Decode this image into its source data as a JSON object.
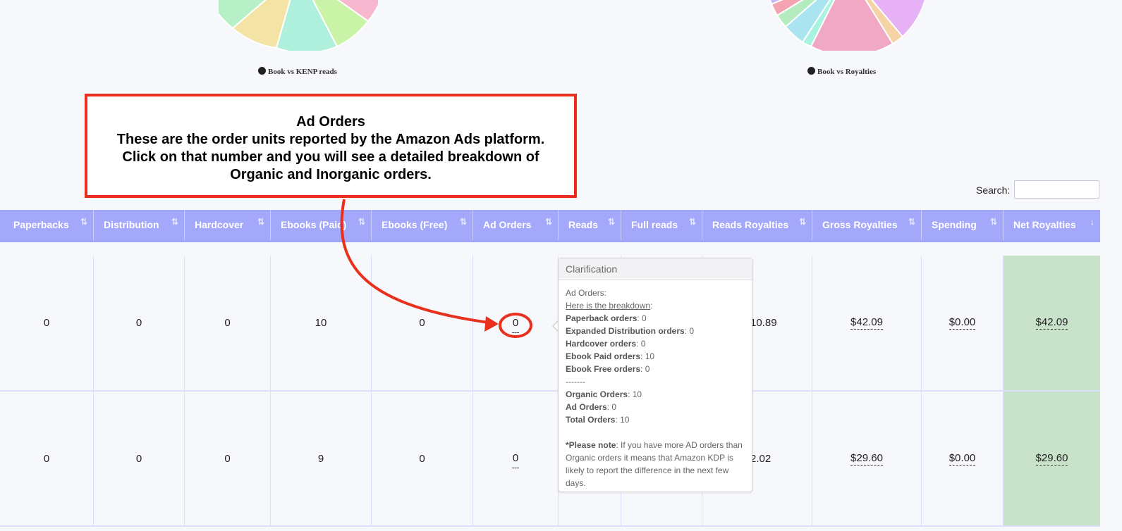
{
  "pies": [
    {
      "legend": "Book vs KENP reads",
      "slices": [
        {
          "color": "#b7f0c6"
        },
        {
          "color": "#f3e3a5"
        },
        {
          "color": "#aef0dc"
        },
        {
          "color": "#c9f3a6"
        },
        {
          "color": "#f7b7cf"
        }
      ]
    },
    {
      "legend": "Book vs Royalties",
      "slices": [
        {
          "color": "#c8b6f5"
        },
        {
          "color": "#f4a3b0"
        },
        {
          "color": "#b4ecc0"
        },
        {
          "color": "#a9e4f0"
        },
        {
          "color": "#a8f2e0"
        },
        {
          "color": "#f1a8c4"
        },
        {
          "color": "#f6d3a5"
        },
        {
          "color": "#e7b2f5"
        }
      ]
    }
  ],
  "callout": {
    "title": "Ad Orders",
    "line1": "These are the order units reported by the Amazon Ads platform.",
    "line2": "Click on that number and you will see a detailed breakdown of",
    "line3": "Organic and Inorganic orders."
  },
  "search": {
    "label": "Search:",
    "value": ""
  },
  "table": {
    "columns": [
      {
        "label": "Paperbacks",
        "sort": "⇅"
      },
      {
        "label": "Distribution",
        "sort": "⇅"
      },
      {
        "label": "Hardcover",
        "sort": "⇅"
      },
      {
        "label": "Ebooks (Paid)",
        "sort": "⇅"
      },
      {
        "label": "Ebooks (Free)",
        "sort": "⇅"
      },
      {
        "label": "Ad Orders",
        "sort": "⇅"
      },
      {
        "label": "Reads",
        "sort": "⇅"
      },
      {
        "label": "Full reads",
        "sort": "⇅"
      },
      {
        "label": "Reads Royalties",
        "sort": "⇅"
      },
      {
        "label": "Gross Royalties",
        "sort": "⇅"
      },
      {
        "label": "Spending",
        "sort": "⇅"
      },
      {
        "label": "Net Royalties",
        "sort": "↓"
      }
    ],
    "rows": [
      {
        "paperbacks": "0",
        "distribution": "0",
        "hardcover": "0",
        "ebooks_paid": "10",
        "ebooks_free": "0",
        "ad_orders": "0",
        "reads_royalties": "10.89",
        "gross_royalties": "$42.09",
        "spending": "$0.00",
        "net_royalties": "$42.09"
      },
      {
        "paperbacks": "0",
        "distribution": "0",
        "hardcover": "0",
        "ebooks_paid": "9",
        "ebooks_free": "0",
        "ad_orders": "0",
        "reads_royalties": "2.02",
        "gross_royalties": "$29.60",
        "spending": "$0.00",
        "net_royalties": "$29.60"
      }
    ]
  },
  "popover": {
    "title": "Clarification",
    "intro": "Ad Orders:",
    "link": "Here is the breakdown",
    "items": [
      {
        "label": "Paperback orders",
        "value": ": 0"
      },
      {
        "label": "Expanded Distribution orders",
        "value": ": 0"
      },
      {
        "label": "Hardcover orders",
        "value": ": 0"
      },
      {
        "label": "Ebook Paid orders",
        "value": ": 10"
      },
      {
        "label": "Ebook Free orders",
        "value": ": 0"
      }
    ],
    "separator": "-------",
    "totals": [
      {
        "label": "Organic Orders",
        "value": ": 10"
      },
      {
        "label": "Ad Orders",
        "value": ": 0"
      },
      {
        "label": "Total Orders",
        "value": ": 10"
      }
    ],
    "note_label": "*Please note",
    "note_text": ": If you have more AD orders than Organic orders it means that Amazon KDP is likely to report the difference in the next few days."
  }
}
